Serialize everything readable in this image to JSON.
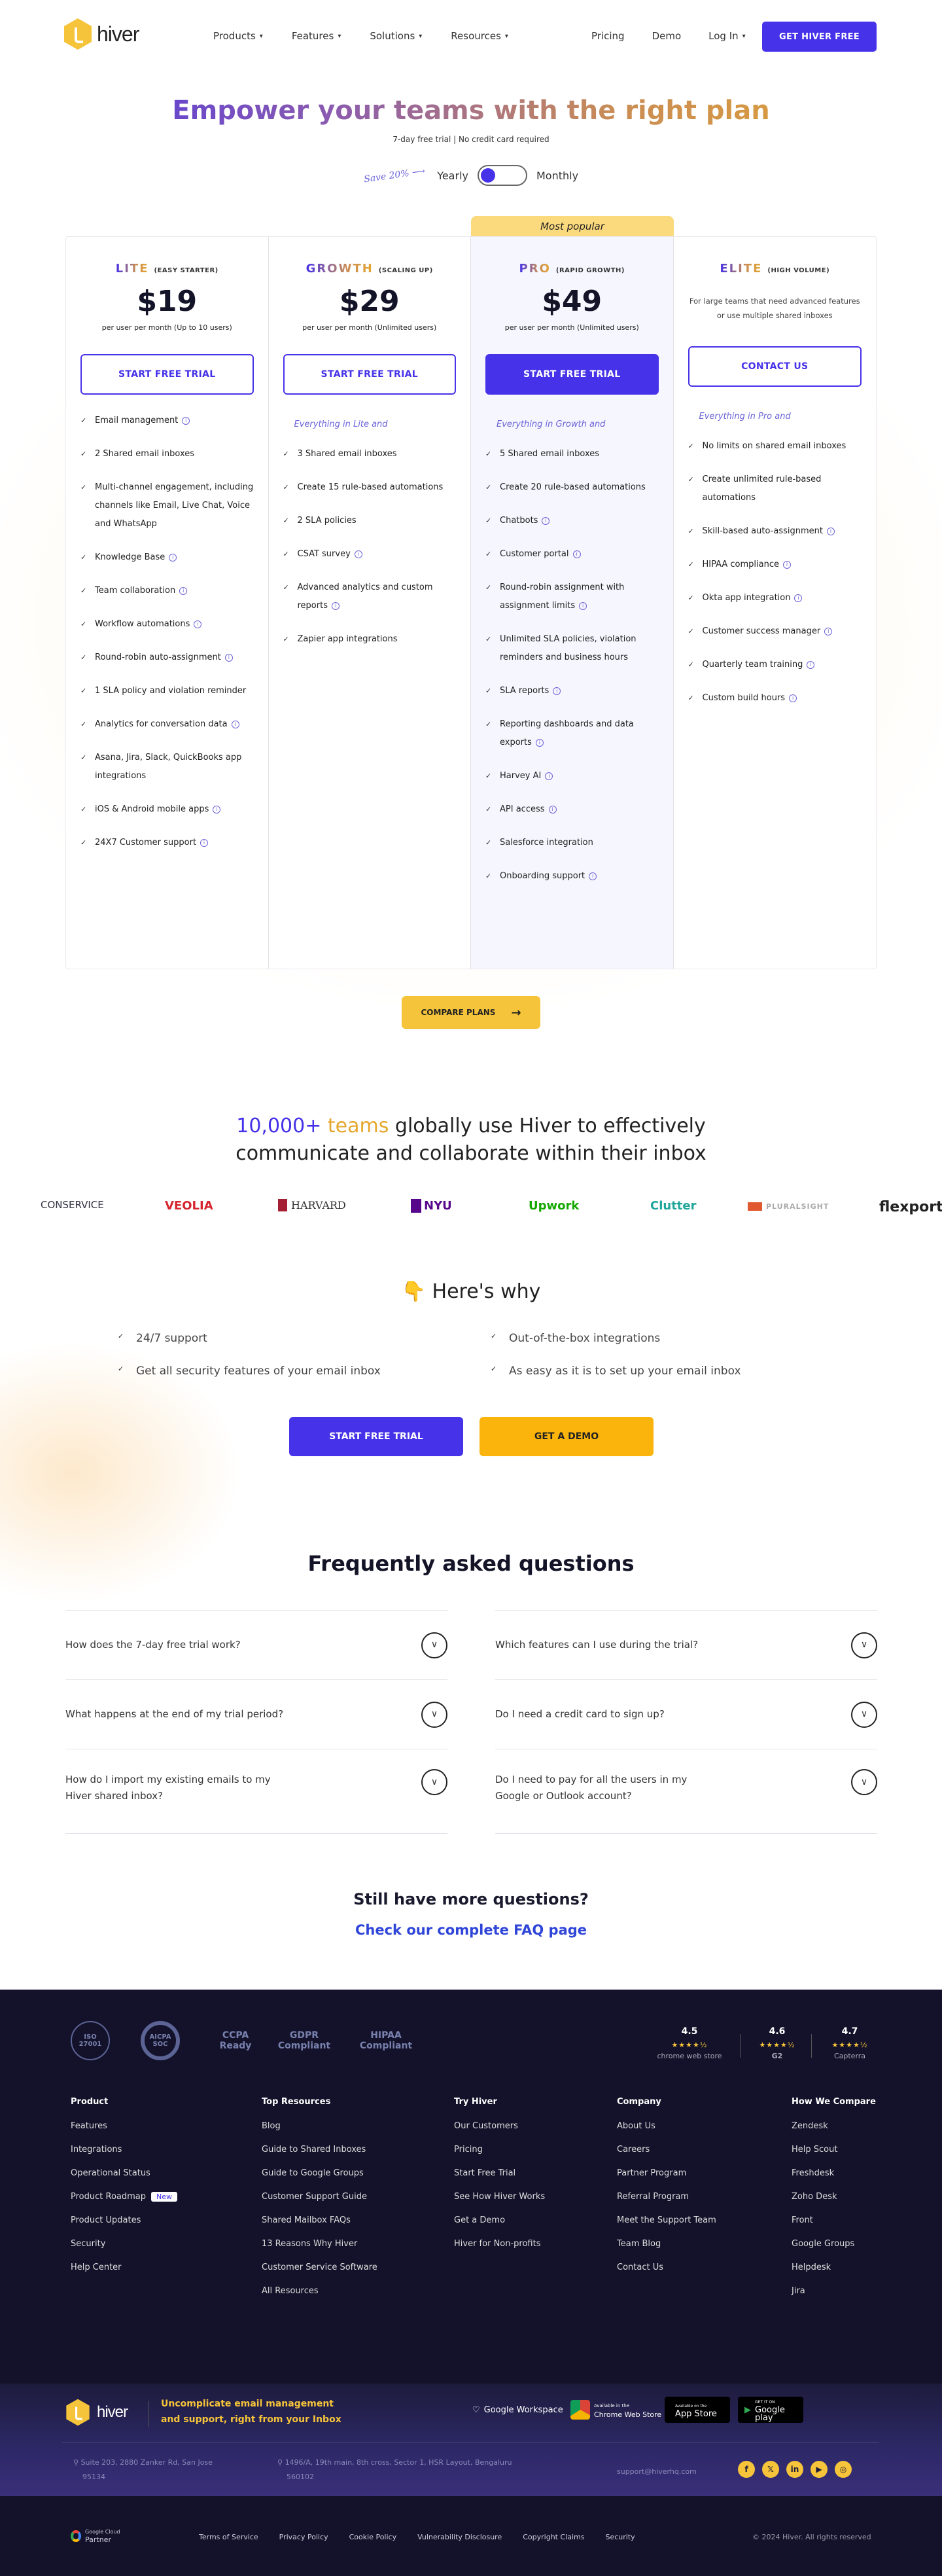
{
  "header": {
    "logo_text": "hiver",
    "nav": [
      {
        "label": "Products",
        "has_dropdown": true
      },
      {
        "label": "Features",
        "has_dropdown": true
      },
      {
        "label": "Solutions",
        "has_dropdown": true
      },
      {
        "label": "Resources",
        "has_dropdown": true
      }
    ],
    "right_nav": [
      {
        "label": "Pricing"
      },
      {
        "label": "Demo"
      },
      {
        "label": "Log In",
        "has_dropdown": true
      }
    ],
    "cta": "GET HIVER FREE",
    "chevron": "▾"
  },
  "hero": {
    "title": "Empower your teams with the right plan",
    "subtitle": "7-day free trial | No credit card required",
    "save_label": "Save 20% ⟶",
    "yearly_label": "Yearly",
    "monthly_label": "Monthly",
    "billing_selected": "Yearly"
  },
  "plans": {
    "most_popular": "Most popular",
    "items": [
      {
        "name": "LITE",
        "tagline": "(EASY STARTER)",
        "price": "$19",
        "per": "per user per month (Up to 10 users)",
        "button": "START FREE TRIAL",
        "features": [
          {
            "text": "Email management",
            "info": true
          },
          {
            "text": "2 Shared email inboxes",
            "info": false
          },
          {
            "text": "Multi-channel engagement, including channels like Email, Live Chat, Voice and WhatsApp",
            "info": false
          },
          {
            "text": "Knowledge Base",
            "info": true
          },
          {
            "text": "Team collaboration",
            "info": true
          },
          {
            "text": "Workflow automations",
            "info": true
          },
          {
            "text": "Round-robin auto-assignment",
            "info": true
          },
          {
            "text": "1 SLA policy and violation reminder",
            "info": false
          },
          {
            "text": "Analytics for conversation data",
            "info": true
          },
          {
            "text": "Asana, Jira, Slack, QuickBooks app integrations",
            "info": false
          },
          {
            "text": "iOS & Android mobile apps",
            "info": true
          },
          {
            "text": "24X7 Customer support",
            "info": true
          }
        ]
      },
      {
        "name": "GROWTH",
        "tagline": "(SCALING UP)",
        "price": "$29",
        "per": "per user per month (Unlimited users)",
        "button": "START FREE TRIAL",
        "everything": "Everything in Lite and",
        "features": [
          {
            "text": "3 Shared email inboxes",
            "info": false
          },
          {
            "text": "Create 15 rule-based automations",
            "info": false
          },
          {
            "text": "2 SLA policies",
            "info": false
          },
          {
            "text": "CSAT survey",
            "info": true
          },
          {
            "text": "Advanced analytics and custom reports",
            "info": true
          },
          {
            "text": "Zapier app integrations",
            "info": false
          }
        ]
      },
      {
        "name": "PRO",
        "tagline": "(RAPID GROWTH)",
        "price": "$49",
        "per": "per user per month (Unlimited users)",
        "button": "START FREE TRIAL",
        "everything": "Everything in Growth and",
        "features": [
          {
            "text": "5 Shared email inboxes",
            "info": false
          },
          {
            "text": "Create 20 rule-based automations",
            "info": false
          },
          {
            "text": "Chatbots",
            "info": true
          },
          {
            "text": "Customer portal",
            "info": true
          },
          {
            "text": "Round-robin assignment with assignment limits",
            "info": true
          },
          {
            "text": "Unlimited SLA policies, violation reminders and business hours",
            "info": false
          },
          {
            "text": "SLA reports",
            "info": true
          },
          {
            "text": "Reporting dashboards and data exports",
            "info": true
          },
          {
            "text": "Harvey AI",
            "info": true
          },
          {
            "text": "API access",
            "info": true
          },
          {
            "text": "Salesforce integration",
            "info": false
          },
          {
            "text": "Onboarding support",
            "info": true
          }
        ]
      },
      {
        "name": "ELITE",
        "tagline": "(HIGH VOLUME)",
        "description": "For large teams that need advanced features or use multiple shared inboxes",
        "button": "CONTACT US",
        "everything": "Everything in Pro and",
        "features": [
          {
            "text": "No limits on shared email inboxes",
            "info": false
          },
          {
            "text": "Create unlimited rule-based automations",
            "info": false
          },
          {
            "text": "Skill-based auto-assignment",
            "info": true
          },
          {
            "text": "HIPAA compliance",
            "info": true
          },
          {
            "text": "Okta app integration",
            "info": true
          },
          {
            "text": "Customer success manager",
            "info": true
          },
          {
            "text": "Quarterly team training",
            "info": true
          },
          {
            "text": "Custom build hours",
            "info": true
          }
        ]
      }
    ],
    "compare_label": "COMPARE PLANS",
    "compare_arrow": "→",
    "check": "✓",
    "info_glyph": "i"
  },
  "social_proof": {
    "count": "10,000+",
    "teams": "teams",
    "line1_rest": " globally use Hiver to effectively",
    "line2": "communicate and collaborate within their inbox",
    "logos": [
      "CONSERVICE",
      "VEOLIA",
      "HARVARD",
      "NYU",
      "Upwork",
      "Clutter",
      "PLURALSIGHT",
      "flexport"
    ]
  },
  "why": {
    "emoji": "👇",
    "title": "Here's why",
    "items": [
      "24/7 support",
      "Out-of-the-box integrations",
      "Get all security features of your email inbox",
      "As easy as it is to set up your email inbox"
    ],
    "trial_button": "START FREE TRIAL",
    "demo_button": "GET A DEMO"
  },
  "faq": {
    "title": "Frequently asked questions",
    "items": [
      "How does the 7-day free trial work?",
      "Which features can I use during the trial?",
      "What happens at the end of my trial period?",
      "Do I need a credit card to sign up?",
      "How do I import my existing emails to my Hiver shared inbox?",
      "Do I need to pay for all the users in my Google or Outlook account?"
    ],
    "chevron": "∨",
    "still_title": "Still have more questions?",
    "link": "Check our complete FAQ page"
  },
  "footer": {
    "certs": [
      "ISO 27001",
      "AICPA SOC",
      "CCPA Ready",
      "GDPR Compliant",
      "HIPAA Compliant"
    ],
    "ratings": [
      {
        "value": "4.5",
        "stars": "★★★★½",
        "source": "chrome web store"
      },
      {
        "value": "4.6",
        "stars": "★★★★½",
        "source": "G2"
      },
      {
        "value": "4.7",
        "stars": "★★★★½",
        "source": "Capterra"
      }
    ],
    "columns": [
      {
        "title": "Product",
        "links": [
          "Features",
          "Integrations",
          "Operational Status",
          "Product Roadmap",
          "Product Updates",
          "Security",
          "Help Center"
        ],
        "badge": "New"
      },
      {
        "title": "Top Resources",
        "links": [
          "Blog",
          "Guide to Shared Inboxes",
          "Guide to Google Groups",
          "Customer Support Guide",
          "Shared Mailbox FAQs",
          "13 Reasons Why Hiver",
          "Customer Service Software",
          "All Resources"
        ]
      },
      {
        "title": "Try Hiver",
        "links": [
          "Our Customers",
          "Pricing",
          "Start Free Trial",
          "See How Hiver Works",
          "Get a Demo",
          "Hiver for Non-profits"
        ]
      },
      {
        "title": "Company",
        "links": [
          "About Us",
          "Careers",
          "Partner Program",
          "Referral Program",
          "Meet the Support Team",
          "Team Blog",
          "Contact Us"
        ]
      },
      {
        "title": "How We Compare",
        "links": [
          "Zendesk",
          "Help Scout",
          "Freshdesk",
          "Zoho Desk",
          "Front",
          "Google Groups",
          "Helpdesk",
          "Jira"
        ]
      }
    ],
    "tagline_1": "Uncomplicate email management",
    "tagline_2": "and support, right from your Inbox",
    "badges": {
      "workspace": "Google Workspace",
      "chrome_small": "Available in the",
      "chrome": "Chrome Web Store",
      "appstore_small": "Available on the",
      "appstore": "App Store",
      "play_small": "GET IT ON",
      "play": "Google play"
    },
    "address_us_1": "Suite 203, 2880 Zanker Rd, San Jose",
    "address_us_2": "95134",
    "address_in_1": "1496/A, 19th main, 8th cross, Sector 1, HSR Layout, Bengaluru",
    "address_in_2": "560102",
    "email": "support@hiverhq.com",
    "social": [
      "f",
      "𝕏",
      "in",
      "▶",
      "◎"
    ],
    "partner_small": "Google Cloud",
    "partner": "Partner",
    "legal_links": [
      "Terms of Service",
      "Privacy Policy",
      "Cookie Policy",
      "Vulnerability Disclosure",
      "Copyright Claims",
      "Security"
    ],
    "copyright": "© 2024 Hiver. All rights reserved"
  }
}
